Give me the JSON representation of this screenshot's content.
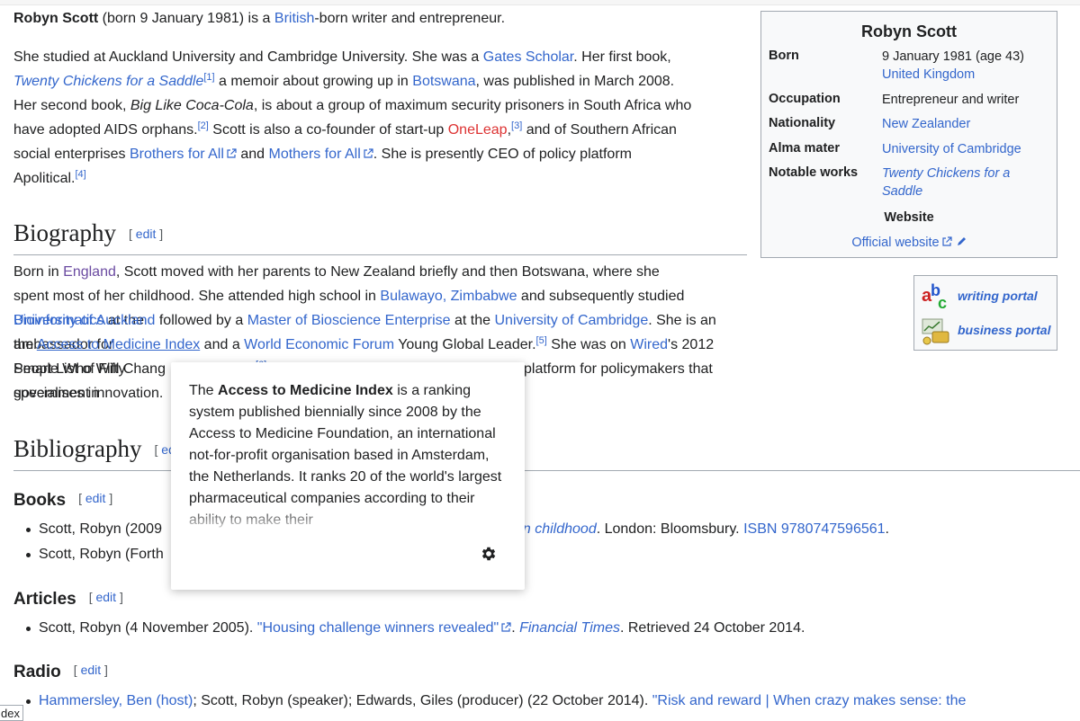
{
  "article": {
    "intro1": {
      "name": "Robyn Scott",
      "rest": " (born 9 January 1981) is a ",
      "link_british": "British",
      "rest2": "-born writer and entrepreneur."
    },
    "intro2": {
      "t1": "She studied at Auckland University and Cambridge University. She was a ",
      "link_gates": "Gates Scholar",
      "t2": ". Her first book,",
      "book1": "Twenty Chickens for a Saddle",
      "ref1": "[1]",
      "t3": " a memoir about growing up in ",
      "link_botswana": "Botswana",
      "t4": ", was published in March 2008.",
      "t5": "Her second book, ",
      "book2": "Big Like Coca-Cola",
      "t6": ", is about a group of maximum security prisoners in South Africa who",
      "t7": "have adopted AIDS orphans.",
      "ref2": "[2]",
      "t8": " Scott is also a co-founder of start-up ",
      "link_oneleap": "OneLeap",
      "ref3": "[3]",
      "t9": " and of Southern African",
      "t10": "social enterprises ",
      "link_brothers": "Brothers for All",
      "t11": " and ",
      "link_mothers": "Mothers for All",
      "t12": ". She is presently CEO of policy platform",
      "t13": "Apolitical.",
      "ref4": "[4]"
    },
    "edit_label": "edit",
    "biography": {
      "heading": "Biography",
      "l1a": "Born in ",
      "link_england": "England",
      "l1b": ", Scott moved with her parents to New Zealand briefly and then Botswana, where she",
      "l2a": "spent most of her childhood. She attended high school in ",
      "link_bulawayo": "Bulawayo, Zimbabwe",
      "l2b": " and subsequently studied ",
      "link_bioinf": "Bioinformatics",
      "l2c": " at the",
      "link_uoa": "University of Auckland",
      "l3a": " followed by a ",
      "link_mbe": "Master of Bioscience Enterprise",
      "l3b": " at the ",
      "link_uoc": "University of Cambridge",
      "l3c": ". She is an ambassador for",
      "l4a": "the ",
      "link_atmi": "Access to Medicine Index",
      "l4b": " and a ",
      "link_wef": "World Economic Forum",
      "l4c": " Young Global Leader.",
      "ref5": "[5]",
      "l4d": " She was on ",
      "link_wired": "Wired",
      "l4e": "'s 2012 Smart List of Fifty",
      "l5a": "People Who Will Chang",
      "ref6": "[6]",
      "l5b": "bal platform for policymakers that specialises in",
      "l6a": "government innovation."
    },
    "bibliography": {
      "heading": "Bibliography",
      "books_heading": "Books",
      "book_item1_a": "Scott, Robyn (2009",
      "book_item1_b": "an childhood",
      "book_item1_c": ". London: Bloomsbury. ",
      "book_item1_isbn": "ISBN 9780747596561",
      "book_item1_d": ".",
      "book_item2_a": "Scott, Robyn (Forth",
      "articles_heading": "Articles",
      "article_item_a": "Scott, Robyn (4 November 2005). ",
      "article_item_link": "\"Housing challenge winners revealed\"",
      "article_item_b": ". ",
      "article_item_pub": "Financial Times",
      "article_item_c": ". Retrieved 24 October 2014.",
      "radio_heading": "Radio",
      "radio_link1": "Hammersley, Ben (host)",
      "radio_a": "; Scott, Robyn (speaker); Edwards, Giles (producer) (22 October 2014). ",
      "radio_link2": "\"Risk and reward | When crazy makes sense: the"
    }
  },
  "infobox": {
    "title": "Robyn Scott",
    "born_label": "Born",
    "born_value": "9 January 1981 (age 43)",
    "born_place": "United Kingdom",
    "occupation_label": "Occupation",
    "occupation_value": "Entrepreneur and writer",
    "nationality_label": "Nationality",
    "nationality_value": "New Zealander",
    "alma_label": "Alma mater",
    "alma_value": "University of Cambridge",
    "works_label": "Notable works",
    "works_value": "Twenty Chickens for a Saddle",
    "website_label": "Website",
    "website_value": "Official website"
  },
  "portals": [
    {
      "label": "writing portal",
      "icon": "abc-writing-icon"
    },
    {
      "label": "business portal",
      "icon": "business-chart-icon"
    }
  ],
  "popup": {
    "text_a": "The ",
    "text_bold": "Access to Medicine Index",
    "text_b": " is a ranking system published biennially since 2008 by the Access to Medicine Foundation, an international not-for-profit organisation based in Amsterdam, the Netherlands. It ranks 20 of the world's largest pharmaceutical companies according to their ability to make their",
    "settings_icon": "gear-icon"
  },
  "side_tooltip": "dex"
}
